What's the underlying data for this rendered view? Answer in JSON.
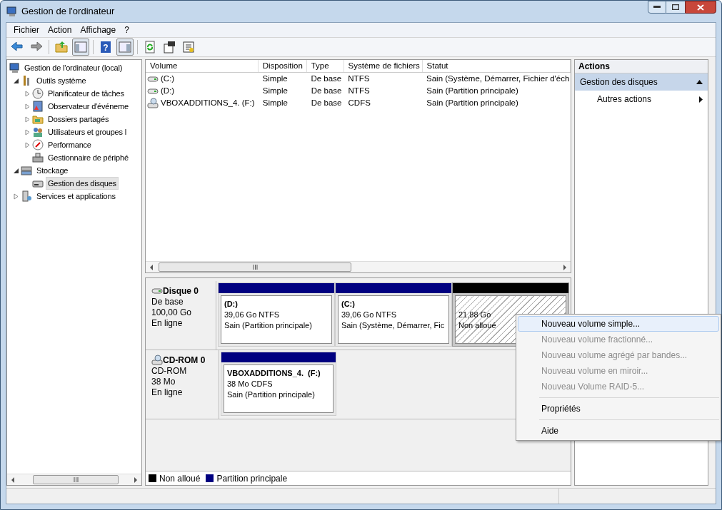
{
  "window": {
    "title": "Gestion de l'ordinateur"
  },
  "menu": [
    "Fichier",
    "Action",
    "Affichage",
    "?"
  ],
  "toolbar": [
    {
      "kind": "back"
    },
    {
      "kind": "forward"
    },
    {
      "kind": "up"
    },
    {
      "kind": "tree-toggle"
    },
    {
      "kind": "help",
      "glyph": "?"
    },
    {
      "kind": "pane-toggle"
    },
    {
      "kind": "refresh"
    },
    {
      "kind": "properties"
    },
    {
      "kind": "export"
    }
  ],
  "tree": [
    {
      "label": "Gestion de l'ordinateur (local)",
      "kind": "computer",
      "selected": false,
      "children": [
        {
          "label": "Outils système",
          "kind": "tools",
          "selected": false,
          "expanded": true,
          "children": [
            {
              "label": "Planificateur de tâches",
              "kind": "clock",
              "selected": false,
              "expanded": false
            },
            {
              "label": "Observateur d'événeme",
              "kind": "log",
              "selected": false,
              "expanded": false
            },
            {
              "label": "Dossiers partagés",
              "kind": "folder",
              "selected": false,
              "expanded": false
            },
            {
              "label": "Utilisateurs et groupes l",
              "kind": "users",
              "selected": false,
              "expanded": false
            },
            {
              "label": "Performance",
              "kind": "gauge",
              "selected": false,
              "expanded": false
            },
            {
              "label": "Gestionnaire de périphé",
              "kind": "devices",
              "selected": false
            }
          ]
        },
        {
          "label": "Stockage",
          "kind": "storage",
          "selected": false,
          "expanded": true,
          "children": [
            {
              "label": "Gestion des disques",
              "kind": "diskmgmt",
              "selected": true
            }
          ]
        },
        {
          "label": "Services et applications",
          "kind": "services",
          "selected": false,
          "expanded": false
        }
      ]
    }
  ],
  "volumes": {
    "columns": [
      "Volume",
      "Disposition",
      "Type",
      "Système de fichiers",
      "Statut"
    ],
    "rows": [
      {
        "kind": "hdd",
        "cells": [
          "(C:)",
          "Simple",
          "De base",
          "NTFS",
          "Sain (Système, Démarrer, Fichier d'éch"
        ]
      },
      {
        "kind": "hdd",
        "cells": [
          "(D:)",
          "Simple",
          "De base",
          "NTFS",
          "Sain (Partition principale)"
        ]
      },
      {
        "kind": "cdrom",
        "cells": [
          "VBOXADDITIONS_4. (F:)",
          "Simple",
          "De base",
          "CDFS",
          "Sain (Partition principale)"
        ]
      }
    ]
  },
  "disks": [
    {
      "name": "Disque 0",
      "kind": "hdd",
      "lines": [
        "De base",
        "100,00 Go",
        "En ligne"
      ],
      "partitions": [
        {
          "kind": "primary",
          "color": "#000080",
          "name": "(D:)",
          "size": "39,06 Go NTFS",
          "status": "Sain (Partition principale)",
          "selected": false
        },
        {
          "kind": "primary",
          "color": "#000080",
          "name": "(C:)",
          "size": "39,06 Go NTFS",
          "status": "Sain (Système, Démarrer, Fic",
          "selected": false
        },
        {
          "kind": "unallocated",
          "color": "#000000",
          "size": "21,88 Go",
          "status": "Non alloué",
          "selected": true
        }
      ]
    },
    {
      "name": "CD-ROM 0",
      "kind": "cdrom",
      "lines": [
        "CD-ROM",
        "38 Mo",
        "En ligne"
      ],
      "partitions": [
        {
          "kind": "primary",
          "color": "#000080",
          "name": "VBOXADDITIONS_4.  (F:)",
          "size": "38 Mo CDFS",
          "status": "Sain (Partition principale)",
          "selected": false
        }
      ]
    }
  ],
  "legend": [
    {
      "label": "Non alloué",
      "color": "#000000"
    },
    {
      "label": "Partition principale",
      "color": "#000080"
    }
  ],
  "actions": {
    "title": "Actions",
    "sections": [
      {
        "label": "Gestion des disques",
        "expanded": true,
        "items": [
          {
            "label": "Autres actions",
            "submenu": true
          }
        ]
      }
    ]
  },
  "context_menu": [
    {
      "kind": "item",
      "label": "Nouveau volume simple...",
      "disabled": false,
      "selected": true
    },
    {
      "kind": "item",
      "label": "Nouveau volume fractionné...",
      "disabled": true,
      "selected": false
    },
    {
      "kind": "item",
      "label": "Nouveau volume agrégé par bandes...",
      "disabled": true,
      "selected": false
    },
    {
      "kind": "item",
      "label": "Nouveau volume en miroir...",
      "disabled": true,
      "selected": false
    },
    {
      "kind": "item",
      "label": "Nouveau Volume RAID-5...",
      "disabled": true,
      "selected": false
    },
    {
      "kind": "separator"
    },
    {
      "kind": "item",
      "label": "Propriétés",
      "disabled": false,
      "selected": false
    },
    {
      "kind": "separator"
    },
    {
      "kind": "item",
      "label": "Aide",
      "disabled": false,
      "selected": false
    }
  ]
}
